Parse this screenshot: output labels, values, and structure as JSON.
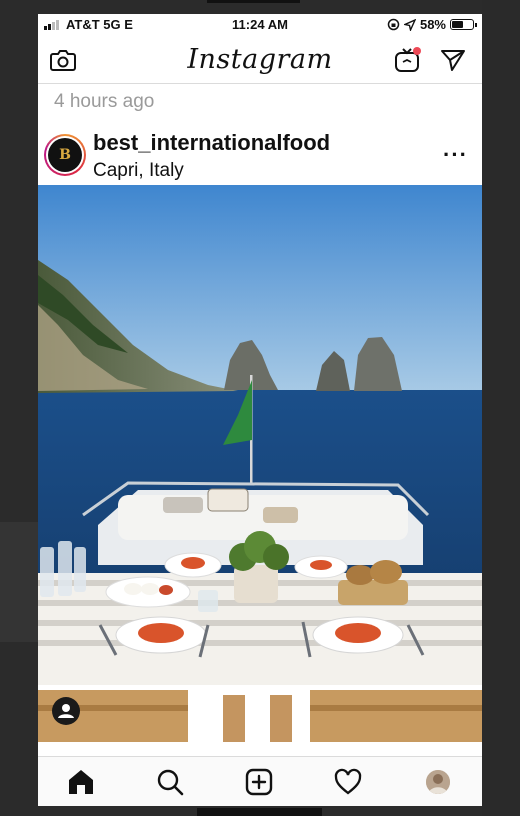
{
  "status_bar": {
    "carrier": "AT&T 5G E",
    "time": "11:24 AM",
    "battery": "58%",
    "battery_level": 0.58
  },
  "header": {
    "title": "Instagram",
    "left_icon": "camera-icon",
    "right_icons": [
      "igtv-icon",
      "direct-message-icon"
    ]
  },
  "post": {
    "time_ago": "4 hours ago",
    "username": "best_internationalfood",
    "location": "Capri, Italy",
    "avatar_letter": "B",
    "more_label": "···",
    "image": "yacht dining table with pasta plates, Capri sea and Faraglioni rocks"
  },
  "tabbar": {
    "items": [
      "home-icon",
      "search-icon",
      "new-post-icon",
      "activity-heart-icon",
      "profile-avatar"
    ]
  },
  "colors": {
    "notification_dot": "#ed4956",
    "sky_top": "#3f86cf",
    "sea": "#1b4f8a"
  }
}
